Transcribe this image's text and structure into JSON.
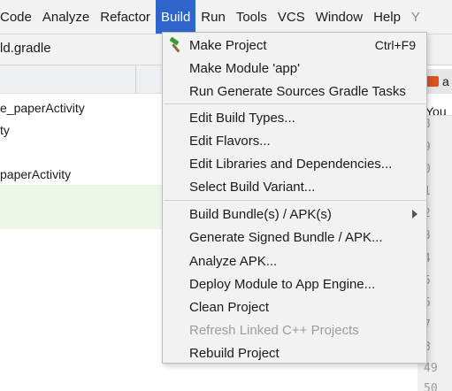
{
  "menubar": {
    "items": [
      {
        "label": "Code",
        "state": "normal"
      },
      {
        "label": "Analyze",
        "state": "normal"
      },
      {
        "label": "Refactor",
        "state": "normal"
      },
      {
        "label": "Build",
        "state": "active"
      },
      {
        "label": "Run",
        "state": "normal"
      },
      {
        "label": "Tools",
        "state": "normal"
      },
      {
        "label": "VCS",
        "state": "normal"
      },
      {
        "label": "Window",
        "state": "normal"
      },
      {
        "label": "Help",
        "state": "normal"
      },
      {
        "label": "Y",
        "state": "dim"
      }
    ]
  },
  "navbar": {
    "file": "ld.gradle"
  },
  "tree": {
    "rows": [
      {
        "label": "e_paperActivity"
      },
      {
        "label": "ty"
      },
      {
        "label": "paperActivity"
      }
    ]
  },
  "editor": {
    "tab_letter": "a",
    "fragment": "You",
    "gutter": [
      "8",
      "9",
      "0",
      "1",
      "2",
      "3",
      "4",
      "5",
      "6",
      "7",
      "8",
      "49",
      "50"
    ]
  },
  "build_menu": {
    "items": [
      {
        "label": "Make Project",
        "shortcut": "Ctrl+F9",
        "icon": "hammer-icon",
        "enabled": true,
        "submenu": false
      },
      {
        "label": "Make Module 'app'",
        "shortcut": "",
        "enabled": true,
        "submenu": false
      },
      {
        "label": "Run Generate Sources Gradle Tasks",
        "shortcut": "",
        "enabled": true,
        "submenu": false
      },
      {
        "separator": true
      },
      {
        "label": "Edit Build Types...",
        "shortcut": "",
        "enabled": true,
        "submenu": false
      },
      {
        "label": "Edit Flavors...",
        "shortcut": "",
        "enabled": true,
        "submenu": false
      },
      {
        "label": "Edit Libraries and Dependencies...",
        "shortcut": "",
        "enabled": true,
        "submenu": false
      },
      {
        "label": "Select Build Variant...",
        "shortcut": "",
        "enabled": true,
        "submenu": false
      },
      {
        "separator": true
      },
      {
        "label": "Build Bundle(s) / APK(s)",
        "shortcut": "",
        "enabled": true,
        "submenu": true
      },
      {
        "label": "Generate Signed Bundle / APK...",
        "shortcut": "",
        "enabled": true,
        "submenu": false
      },
      {
        "label": "Analyze APK...",
        "shortcut": "",
        "enabled": true,
        "submenu": false
      },
      {
        "label": "Deploy Module to App Engine...",
        "shortcut": "",
        "enabled": true,
        "submenu": false
      },
      {
        "label": "Clean Project",
        "shortcut": "",
        "enabled": true,
        "submenu": false
      },
      {
        "label": "Refresh Linked C++ Projects",
        "shortcut": "",
        "enabled": false,
        "submenu": false
      },
      {
        "label": "Rebuild Project",
        "shortcut": "",
        "enabled": true,
        "submenu": false
      }
    ]
  },
  "colors": {
    "accent": "#2f65ca",
    "hammer_green": "#3a9a3a",
    "hammer_handle": "#8a6a3a",
    "file_icon": "#d9541e"
  }
}
